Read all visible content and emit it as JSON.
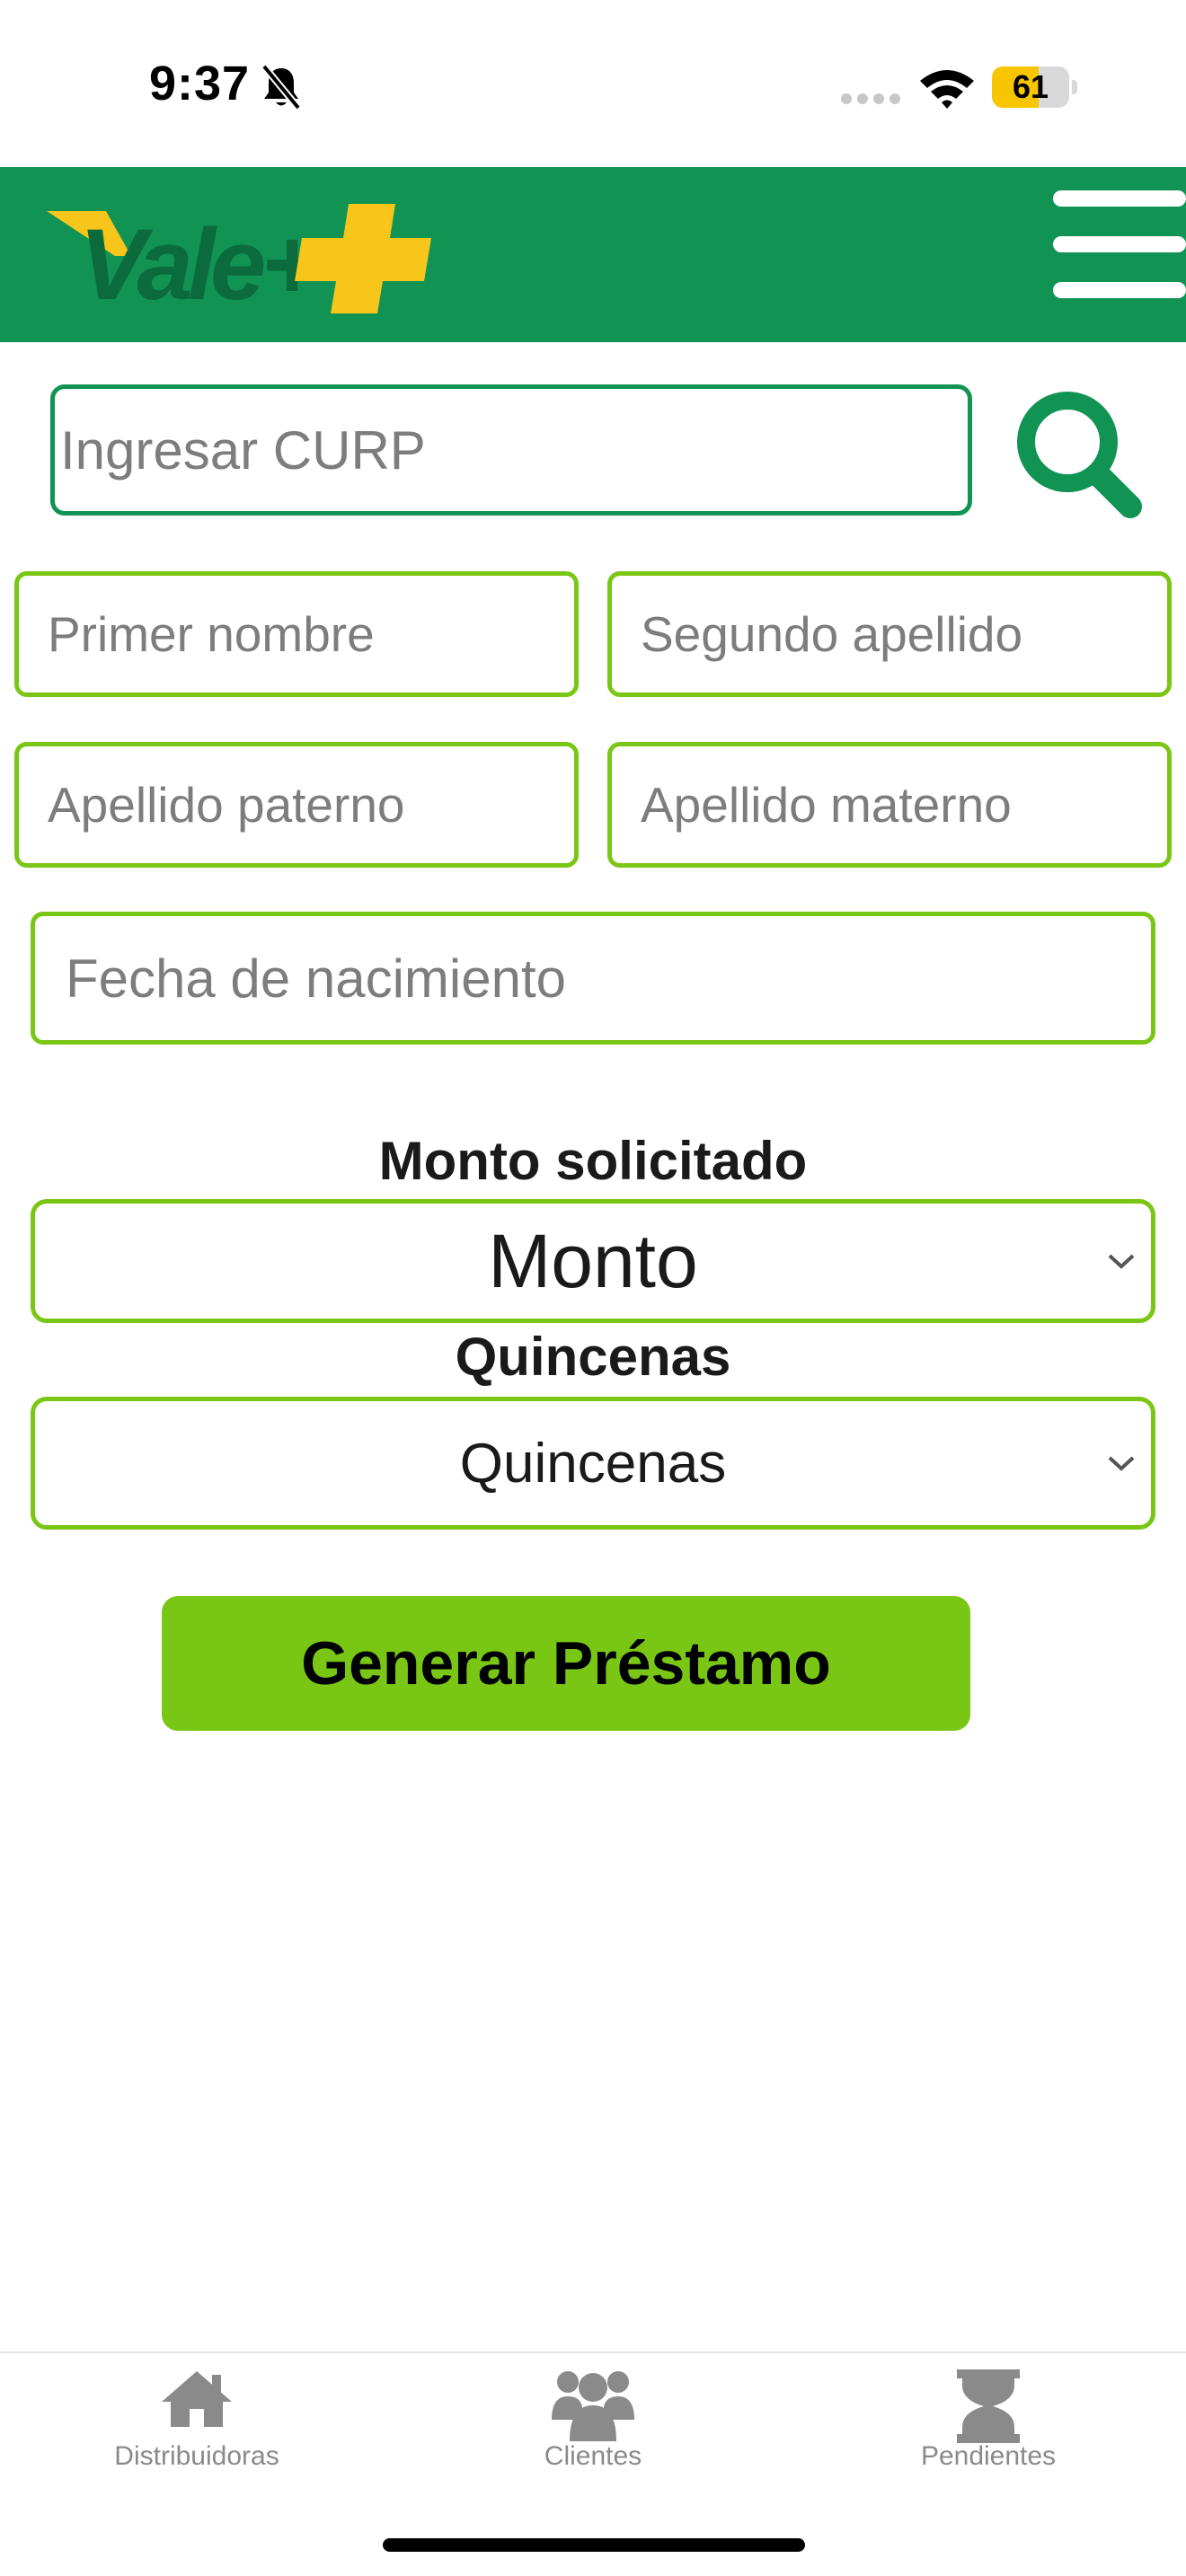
{
  "status_bar": {
    "time": "9:37",
    "battery_level": "61",
    "battery_fraction": 0.61,
    "colors": {
      "battery": "#f7c600"
    }
  },
  "header": {
    "brand": "Vale+",
    "menu_icon": "hamburger-menu-icon",
    "colors": {
      "background": "#119354",
      "brand_plus": "#f8c51a"
    }
  },
  "search": {
    "placeholder": "Ingresar CURP",
    "icon": "search-icon"
  },
  "form": {
    "first_name_placeholder": "Primer nombre",
    "second_surname_placeholder": "Segundo apellido",
    "paternal_surname_placeholder": "Apellido paterno",
    "maternal_surname_placeholder": "Apellido materno",
    "birthdate_placeholder": "Fecha de nacimiento",
    "amount_label": "Monto solicitado",
    "amount_selected": "Monto",
    "installments_label": "Quincenas",
    "installments_selected": "Quincenas",
    "submit_label": "Generar Préstamo",
    "colors": {
      "field_border": "#7ac614",
      "button": "#7ac614"
    }
  },
  "tabbar": {
    "items": [
      {
        "label": "Distribuidoras",
        "icon": "home-icon"
      },
      {
        "label": "Clientes",
        "icon": "users-icon"
      },
      {
        "label": "Pendientes",
        "icon": "hourglass-icon"
      }
    ]
  }
}
